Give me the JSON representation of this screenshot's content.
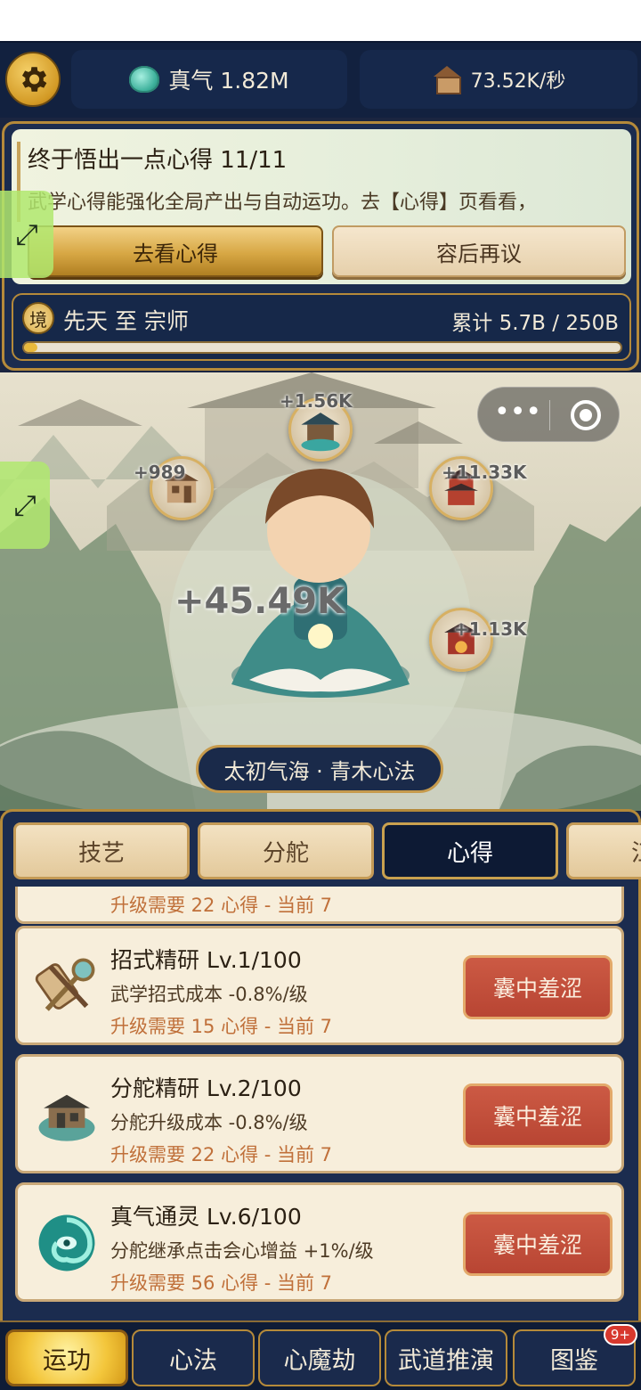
{
  "topbar": {
    "qi_value": "真气 1.82M",
    "rate_value": "73.52K/秒"
  },
  "quest": {
    "title": "终于悟出一点心得  11/11",
    "description": "武学心得能强化全局产出与自动运功。去【心得】页看看，",
    "go_label": "去看心得",
    "later_label": "容后再议"
  },
  "realm": {
    "badge": "境",
    "name": "先天 至 宗师",
    "total": "累计 5.7B / 250B",
    "progress_fraction": 0.0228
  },
  "scene": {
    "buildings": [
      {
        "label": "+1.56K"
      },
      {
        "label": "+989"
      },
      {
        "label": "+11.33K"
      },
      {
        "label": "+1.13K"
      }
    ],
    "gain": "+45.49K",
    "technique": "太初气海 · 青木心法"
  },
  "tabs": [
    {
      "label": "技艺"
    },
    {
      "label": "分舵"
    },
    {
      "label": "心得"
    },
    {
      "label": "江湖"
    }
  ],
  "cards": {
    "partial_req": "升级需要 22 心得 - 当前 7",
    "items": [
      {
        "title": "招式精研  Lv.1/100",
        "desc": "武学招式成本 -0.8%/级",
        "req": "升级需要 15 心得 - 当前 7",
        "button": "囊中羞涩",
        "icon": "scroll-swords-icon"
      },
      {
        "title": "分舵精研  Lv.2/100",
        "desc": "分舵升级成本 -0.8%/级",
        "req": "升级需要 22 心得 - 当前 7",
        "button": "囊中羞涩",
        "icon": "branch-hall-icon"
      },
      {
        "title": "真气通灵  Lv.6/100",
        "desc": "分舵继承点击会心增益 +1%/级",
        "req": "升级需要 56 心得 - 当前 7",
        "button": "囊中羞涩",
        "icon": "spirit-vortex-icon"
      }
    ]
  },
  "nav": [
    {
      "label": "运功"
    },
    {
      "label": "心法"
    },
    {
      "label": "心魔劫"
    },
    {
      "label": "武道推演"
    },
    {
      "label": "图鉴",
      "badge": "9+"
    }
  ],
  "colors": {
    "panel_bg": "#1b2c4f",
    "gold_border": "#b58a3a",
    "card_bg": "#f7eedb",
    "button_red": "#b84533",
    "requirement_text": "#c0703a"
  }
}
